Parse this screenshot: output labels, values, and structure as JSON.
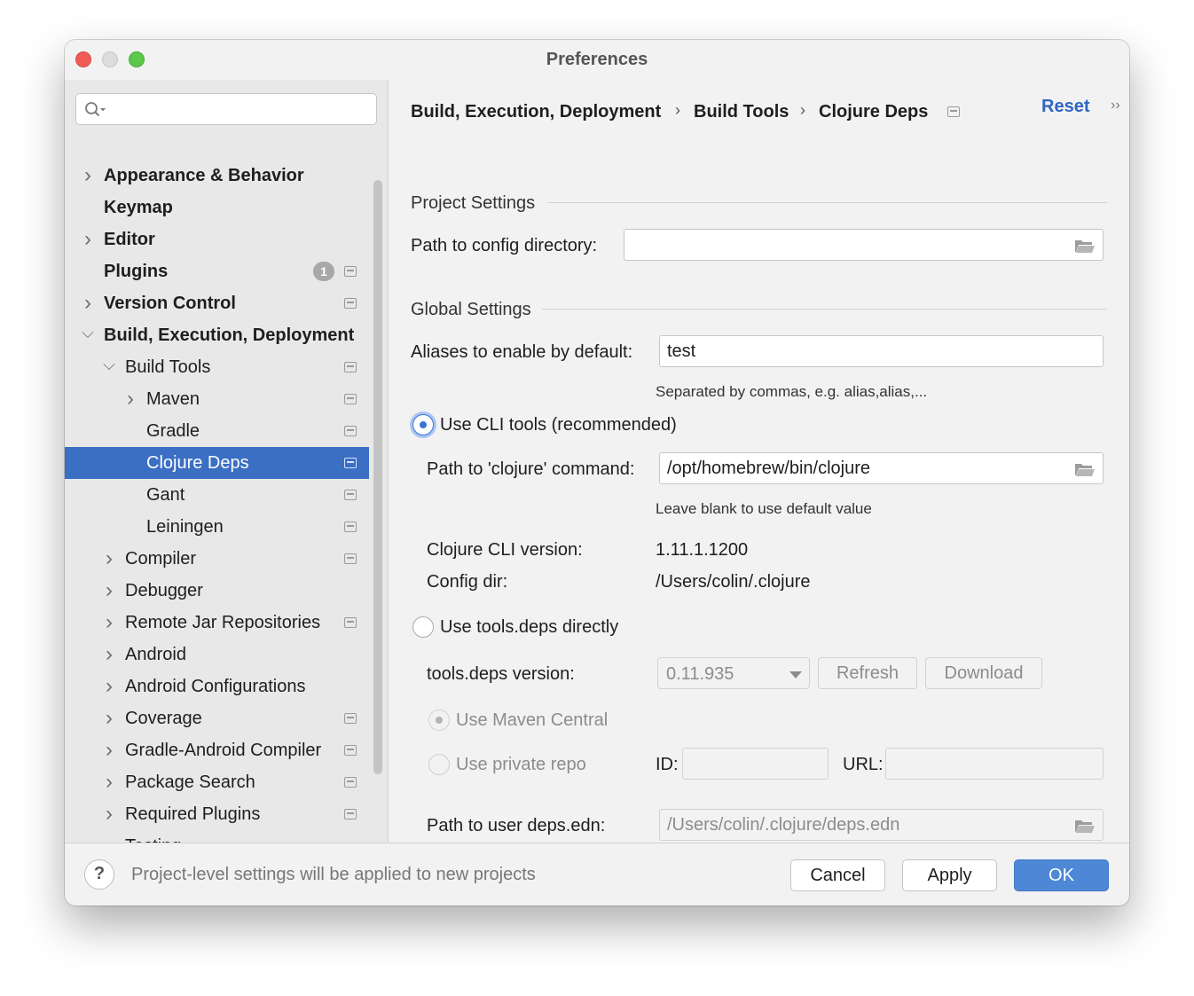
{
  "window": {
    "title": "Preferences"
  },
  "search": {
    "placeholder": "",
    "value": ""
  },
  "sidebar": {
    "items": [
      {
        "label": "Appearance & Behavior",
        "level": 0,
        "bold": true,
        "chevron": "right"
      },
      {
        "label": "Keymap",
        "level": 0,
        "bold": true,
        "chevron": ""
      },
      {
        "label": "Editor",
        "level": 0,
        "bold": true,
        "chevron": "right"
      },
      {
        "label": "Plugins",
        "level": 0,
        "bold": true,
        "chevron": "",
        "badge": "1",
        "project": true
      },
      {
        "label": "Version Control",
        "level": 0,
        "bold": true,
        "chevron": "right",
        "project": true
      },
      {
        "label": "Build, Execution, Deployment",
        "level": 0,
        "bold": true,
        "chevron": "down"
      },
      {
        "label": "Build Tools",
        "level": 1,
        "chevron": "down",
        "project": true
      },
      {
        "label": "Maven",
        "level": 2,
        "chevron": "right",
        "project": true
      },
      {
        "label": "Gradle",
        "level": 2,
        "chevron": "",
        "project": true
      },
      {
        "label": "Clojure Deps",
        "level": 2,
        "chevron": "",
        "project": true,
        "selected": true
      },
      {
        "label": "Gant",
        "level": 2,
        "chevron": "",
        "project": true
      },
      {
        "label": "Leiningen",
        "level": 2,
        "chevron": "",
        "project": true
      },
      {
        "label": "Compiler",
        "level": 1,
        "chevron": "right",
        "project": true
      },
      {
        "label": "Debugger",
        "level": 1,
        "chevron": "right"
      },
      {
        "label": "Remote Jar Repositories",
        "level": 1,
        "chevron": "right",
        "project": true
      },
      {
        "label": "Android",
        "level": 1,
        "chevron": "right"
      },
      {
        "label": "Android Configurations",
        "level": 1,
        "chevron": "right"
      },
      {
        "label": "Coverage",
        "level": 1,
        "chevron": "right",
        "project": true
      },
      {
        "label": "Gradle-Android Compiler",
        "level": 1,
        "chevron": "right",
        "project": true
      },
      {
        "label": "Package Search",
        "level": 1,
        "chevron": "right",
        "project": true
      },
      {
        "label": "Required Plugins",
        "level": 1,
        "chevron": "right",
        "project": true
      },
      {
        "label": "Testing",
        "level": 1,
        "chevron": "right"
      }
    ]
  },
  "breadcrumb": {
    "items": [
      "Build, Execution, Deployment",
      "Build Tools",
      "Clojure Deps"
    ],
    "separator": "›"
  },
  "header": {
    "reset": "Reset",
    "more": "››"
  },
  "project_settings": {
    "title": "Project Settings",
    "config_dir_label": "Path to config directory:",
    "config_dir_value": ""
  },
  "global_settings": {
    "title": "Global Settings",
    "aliases_label": "Aliases to enable by default:",
    "aliases_value": "test",
    "aliases_hint": "Separated by commas, e.g. alias,alias,..."
  },
  "cli": {
    "radio_label": "Use CLI tools (recommended)",
    "path_label": "Path to 'clojure' command:",
    "path_value": "/opt/homebrew/bin/clojure",
    "path_hint": "Leave blank to use default value",
    "version_label": "Clojure CLI version:",
    "version_value": "1.11.1.1200",
    "config_label": "Config dir:",
    "config_value": "/Users/colin/.clojure"
  },
  "tools_deps": {
    "radio_label": "Use tools.deps directly",
    "version_label": "tools.deps version:",
    "version_value": "0.11.935",
    "refresh": "Refresh",
    "download": "Download",
    "maven_central": "Use Maven Central",
    "private_repo": "Use private repo",
    "id_label": "ID:",
    "id_value": "",
    "url_label": "URL:",
    "url_value": "",
    "user_deps_label": "Path to user deps.edn:",
    "user_deps_value": "/Users/colin/.clojure/deps.edn"
  },
  "footer": {
    "help": "?",
    "message": "Project-level settings will be applied to new projects",
    "cancel": "Cancel",
    "apply": "Apply",
    "ok": "OK"
  },
  "colors": {
    "accent": "#3a6fc4",
    "link": "#2f65c3",
    "primary_button": "#4d87d6"
  }
}
